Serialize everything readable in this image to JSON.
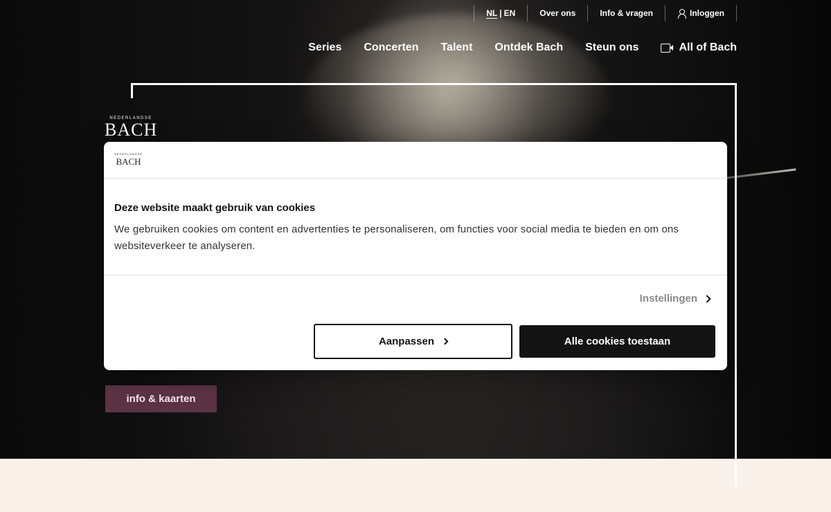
{
  "util_nav": {
    "lang_nl": "NL",
    "lang_sep": "|",
    "lang_en": "EN",
    "about": "Over ons",
    "info": "Info & vragen",
    "login": "Inloggen"
  },
  "main_nav": {
    "items": [
      {
        "label": "Series"
      },
      {
        "label": "Concerten"
      },
      {
        "label": "Talent"
      },
      {
        "label": "Ontdek Bach"
      },
      {
        "label": "Steun ons"
      }
    ],
    "all_of_bach": "All of Bach"
  },
  "hero": {
    "logo_small": "NEDERLANDSE",
    "logo_big": "BACH",
    "cta_label": "info & kaarten"
  },
  "cookie_dialog": {
    "logo_small": "NEDERLANDSE",
    "logo_big": "BACH",
    "title": "Deze website maakt gebruik van cookies",
    "text": "We gebruiken cookies om content en advertenties te personaliseren, om functies voor social media te bieden en om ons websiteverkeer te analyseren.",
    "settings_label": "Instellingen",
    "customize_label": "Aanpassen",
    "accept_label": "Alle cookies toestaan"
  },
  "colors": {
    "cta_bg": "#5c3345",
    "accept_bg": "#141414",
    "page_bg": "#f9f1ea"
  }
}
